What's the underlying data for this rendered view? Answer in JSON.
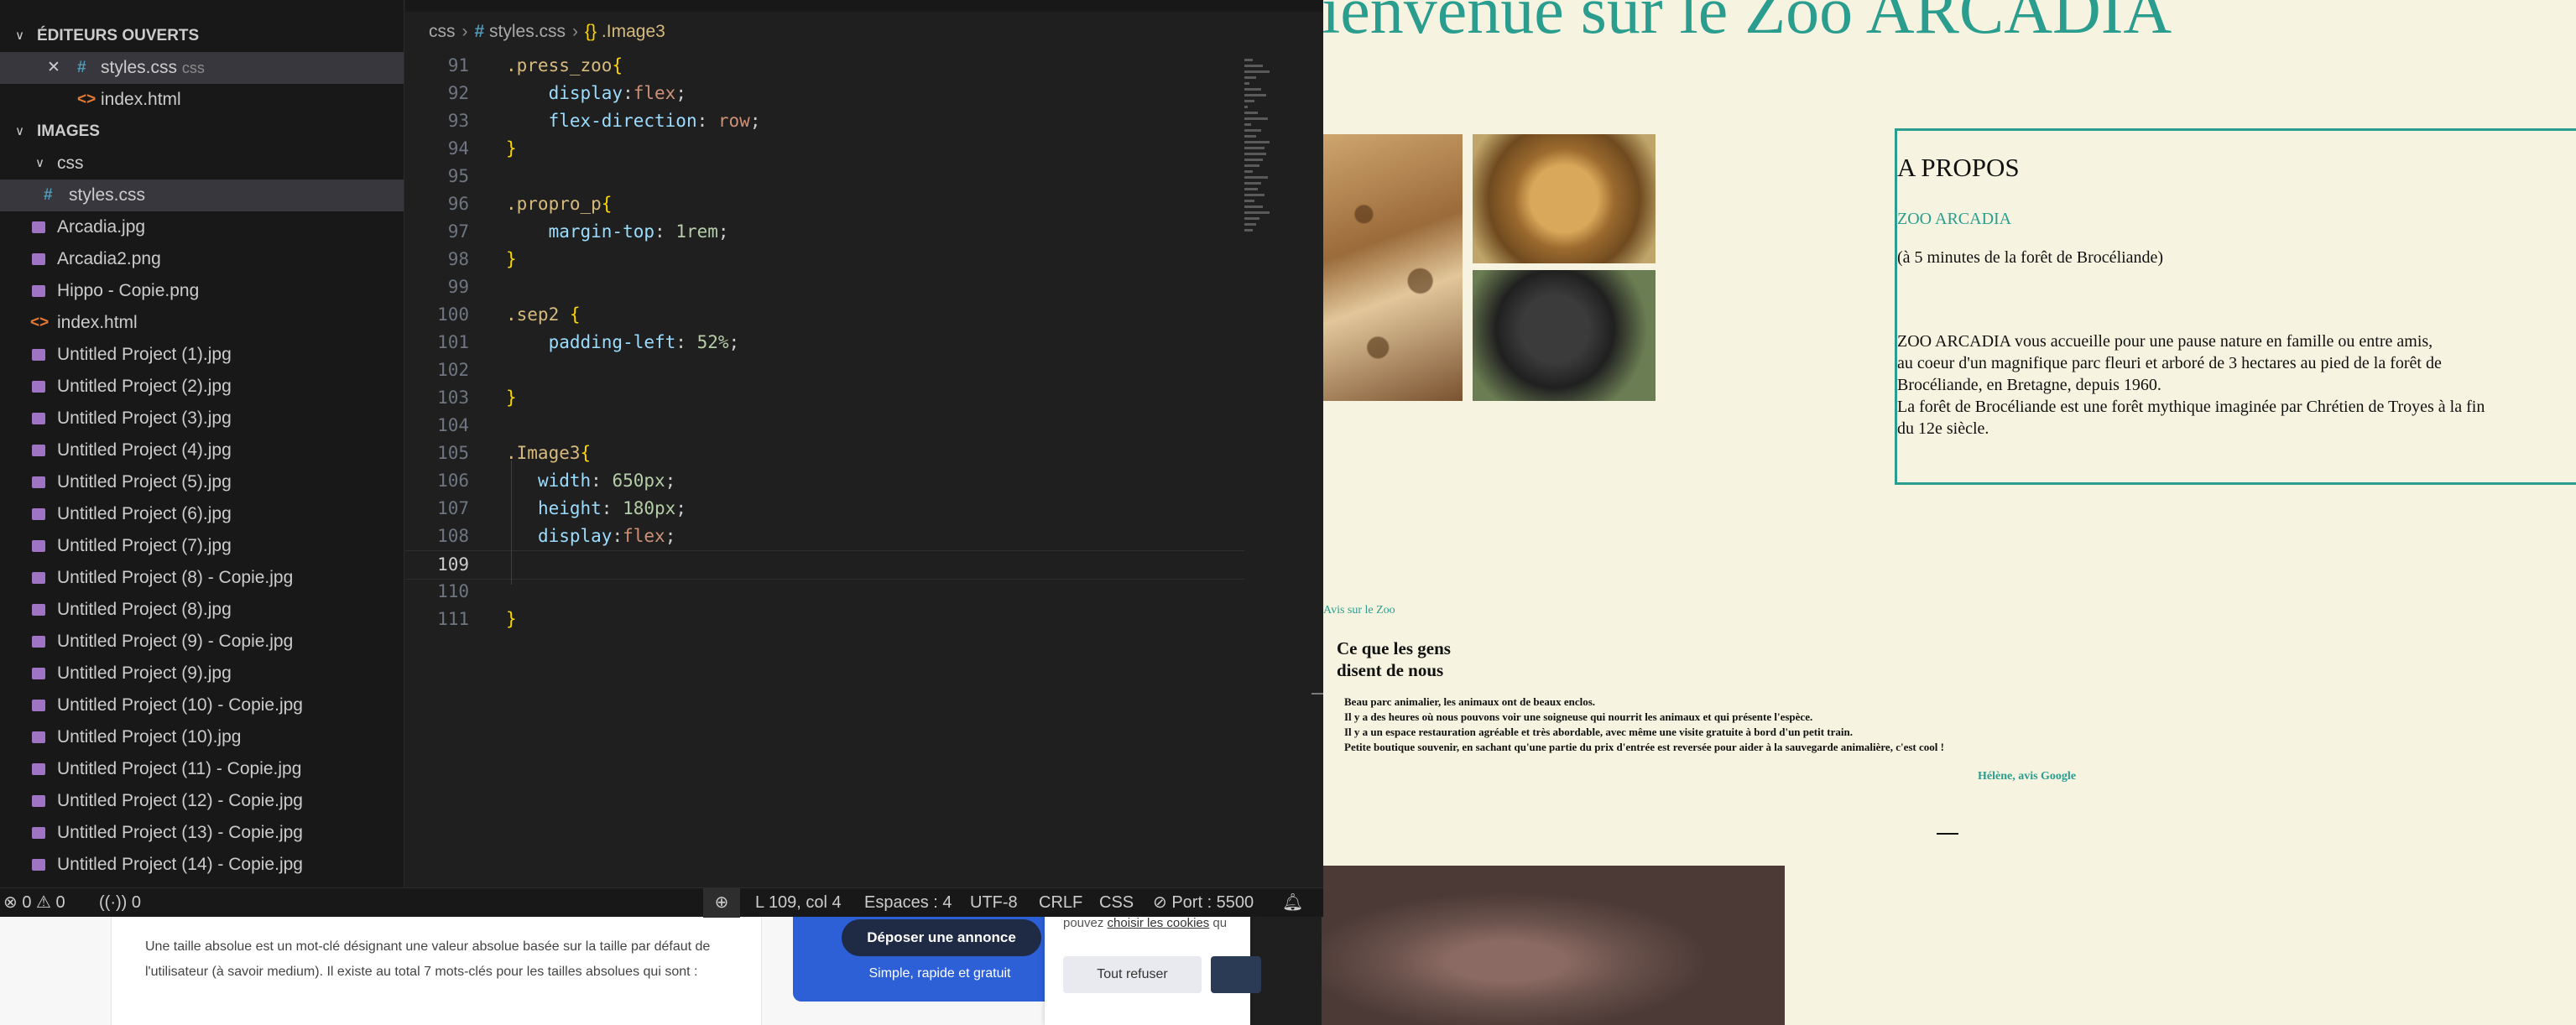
{
  "bg_page": {
    "paragraph": "Une taille absolue est un mot-clé désignant une valeur absolue basée sur la taille par défaut de l'utilisateur (à savoir medium). Il existe au total 7 mots-clés pour les tailles absolues qui sont :",
    "promo_button": "Déposer une annonce",
    "promo_sub": "Simple, rapide et gratuit",
    "cookie_prefix": "pouvez ",
    "cookie_link": "choisir les cookies",
    "cookie_suffix": " qu",
    "cookie_refuse": "Tout refuser"
  },
  "explorer": {
    "open_editors_title": "ÉDITEURS OUVERTS",
    "open_editors": [
      {
        "name": "styles.css",
        "folder": "css",
        "icon": "css-file-icon"
      },
      {
        "name": "index.html",
        "icon": "html-file-icon"
      }
    ],
    "folder_title": "IMAGES",
    "subfolder": "css",
    "files": [
      "styles.css",
      "Arcadia.jpg",
      "Arcadia2.png",
      "Hippo - Copie.png",
      "index.html",
      "Untitled Project (1).jpg",
      "Untitled Project (2).jpg",
      "Untitled Project (3).jpg",
      "Untitled Project (4).jpg",
      "Untitled Project (5).jpg",
      "Untitled Project (6).jpg",
      "Untitled Project (7).jpg",
      "Untitled Project (8) - Copie.jpg",
      "Untitled Project (8).jpg",
      "Untitled Project (9) - Copie.jpg",
      "Untitled Project (9).jpg",
      "Untitled Project (10) - Copie.jpg",
      "Untitled Project (10).jpg",
      "Untitled Project (11) - Copie.jpg",
      "Untitled Project (12) - Copie.jpg",
      "Untitled Project (13) - Copie.jpg",
      "Untitled Project (14) - Copie.jpg"
    ]
  },
  "breadcrumb": {
    "folder": "css",
    "file": "styles.css",
    "symbol": ".Image3"
  },
  "code_lines": [
    {
      "n": "91",
      "tokens": [
        [
          "sel",
          ".press_zoo"
        ],
        [
          "brace",
          "{"
        ]
      ]
    },
    {
      "n": "92",
      "tokens": [
        [
          "plain",
          "    "
        ],
        [
          "prop",
          "display"
        ],
        [
          "plain",
          ":"
        ],
        [
          "val",
          "flex"
        ],
        [
          "plain",
          ";"
        ]
      ]
    },
    {
      "n": "93",
      "tokens": [
        [
          "plain",
          "    "
        ],
        [
          "prop",
          "flex-direction"
        ],
        [
          "plain",
          ": "
        ],
        [
          "val",
          "row"
        ],
        [
          "plain",
          ";"
        ]
      ]
    },
    {
      "n": "94",
      "tokens": [
        [
          "brace",
          "}"
        ]
      ]
    },
    {
      "n": "95",
      "tokens": []
    },
    {
      "n": "96",
      "tokens": [
        [
          "sel",
          ".propro_p"
        ],
        [
          "brace",
          "{"
        ]
      ]
    },
    {
      "n": "97",
      "tokens": [
        [
          "plain",
          "    "
        ],
        [
          "prop",
          "margin-top"
        ],
        [
          "plain",
          ": "
        ],
        [
          "num",
          "1rem"
        ],
        [
          "plain",
          ";"
        ]
      ]
    },
    {
      "n": "98",
      "tokens": [
        [
          "brace",
          "}"
        ]
      ]
    },
    {
      "n": "99",
      "tokens": []
    },
    {
      "n": "100",
      "tokens": [
        [
          "sel",
          ".sep2"
        ],
        [
          "plain",
          " "
        ],
        [
          "brace",
          "{"
        ]
      ]
    },
    {
      "n": "101",
      "tokens": [
        [
          "plain",
          "    "
        ],
        [
          "prop",
          "padding-left"
        ],
        [
          "plain",
          ": "
        ],
        [
          "num",
          "52%"
        ],
        [
          "plain",
          ";"
        ]
      ]
    },
    {
      "n": "102",
      "tokens": []
    },
    {
      "n": "103",
      "tokens": [
        [
          "brace",
          "}"
        ]
      ]
    },
    {
      "n": "104",
      "tokens": []
    },
    {
      "n": "105",
      "tokens": [
        [
          "sel",
          ".Image3"
        ],
        [
          "brace",
          "{"
        ]
      ]
    },
    {
      "n": "106",
      "tokens": [
        [
          "plain",
          "   "
        ],
        [
          "prop",
          "width"
        ],
        [
          "plain",
          ": "
        ],
        [
          "num",
          "650px"
        ],
        [
          "plain",
          ";"
        ]
      ]
    },
    {
      "n": "107",
      "tokens": [
        [
          "plain",
          "   "
        ],
        [
          "prop",
          "height"
        ],
        [
          "plain",
          ": "
        ],
        [
          "num",
          "180px"
        ],
        [
          "plain",
          ";"
        ]
      ]
    },
    {
      "n": "108",
      "tokens": [
        [
          "plain",
          "   "
        ],
        [
          "prop",
          "display"
        ],
        [
          "plain",
          ":"
        ],
        [
          "val",
          "flex"
        ],
        [
          "plain",
          ";"
        ]
      ]
    },
    {
      "n": "109",
      "tokens": [],
      "current": true
    },
    {
      "n": "110",
      "tokens": []
    },
    {
      "n": "111",
      "tokens": [
        [
          "brace",
          "}"
        ]
      ]
    }
  ],
  "status": {
    "errors": "0",
    "warnings": "0",
    "ports": "0",
    "position": "L 109, col 4",
    "spaces": "Espaces : 4",
    "encoding": "UTF-8",
    "eol": "CRLF",
    "language": "CSS",
    "live_server": "Port : 5500"
  },
  "zoo": {
    "title": "ienvenue sur le Zoo ARCADIA",
    "about_heading": "A PROPOS",
    "about_name": "ZOO ARCADIA",
    "about_location": "(à 5 minutes de la forêt de Brocéliande)",
    "about_lines": [
      "ZOO ARCADIA vous accueille pour une pause nature en famille ou entre amis,",
      "au coeur d'un magnifique parc fleuri et arboré de 3 hectares au pied de la forêt de",
      "Brocéliande, en Bretagne, depuis 1960.",
      "La forêt de Brocéliande est une forêt mythique imaginée par Chrétien de Troyes à la fin",
      "du 12e siècle."
    ],
    "avis_label": "Avis sur le Zoo",
    "avis_title_1": "Ce que les gens",
    "avis_title_2": "disent de nous",
    "review_lines": [
      "Beau parc animalier, les animaux ont de beaux enclos.",
      "Il y a des heures où nous pouvons voir une soigneuse qui nourrit les animaux et qui présente l'espèce.",
      "Il y a un espace restauration agréable et très abordable, avec même une visite gratuite à bord d'un petit train.",
      "Petite boutique souvenir, en sachant qu'une partie du prix d'entrée est reversée pour aider à la sauvegarde animalière, c'est cool !"
    ],
    "review_author": "Hélène, avis Google"
  },
  "colors": {
    "accent_teal": "#2a9d8f",
    "page_bg": "#f6f4e0",
    "editor_bg": "#1f1f1f"
  }
}
